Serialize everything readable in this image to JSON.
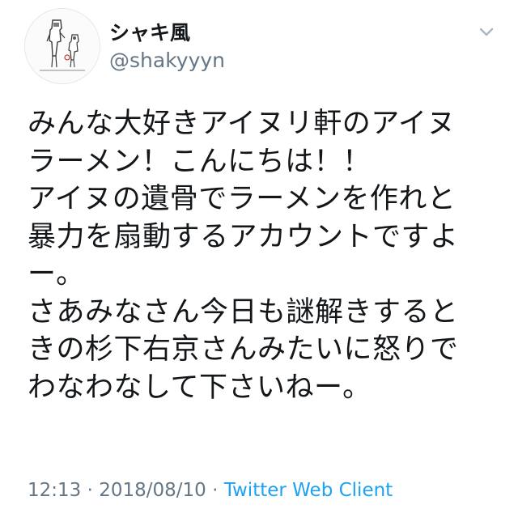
{
  "author": {
    "display_name": "シャキ風",
    "handle": "@shakyyyn"
  },
  "icons": {
    "avatar": "avatar-drawing-icon",
    "menu": "chevron-down-icon"
  },
  "tweet": {
    "lines": [
      "みんな大好きアイヌリ軒のアイヌ",
      "ラーメン！こんにちは！！",
      "アイヌの遺骨でラーメンを作れと",
      "暴力を扇動するアカウントですよ",
      "ー。",
      "さあみなさん今日も謎解きすると",
      "きの杉下右京さんみたいに怒りで",
      "わなわなして下さいねー。"
    ]
  },
  "meta": {
    "time": "12:13",
    "separator": " · ",
    "date": "2018/08/10",
    "source": "Twitter Web Client"
  },
  "colors": {
    "text": "#14171a",
    "secondary": "#657786",
    "link": "#1da1f2"
  }
}
